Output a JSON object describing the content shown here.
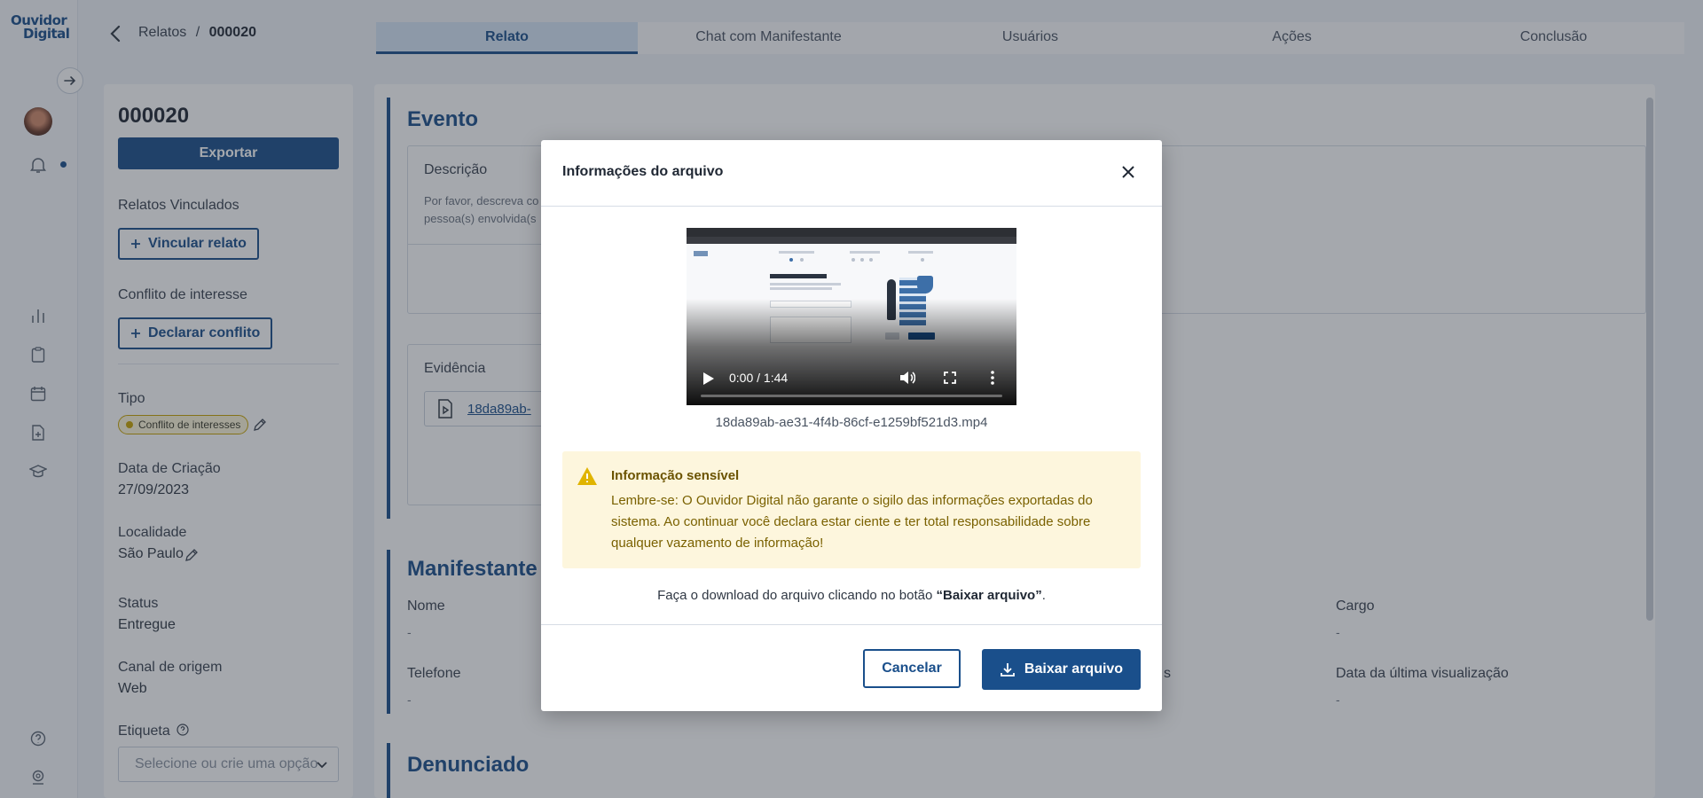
{
  "app": {
    "logo_line1": "Ouvidor",
    "logo_line2": "Digital"
  },
  "rail": {
    "icons": [
      "arrow-right-icon",
      "bell-icon",
      "bar-chart-icon",
      "clipboard-icon",
      "calendar-icon",
      "file-add-icon",
      "graduation-cap-icon",
      "help-circle-icon",
      "location-icon"
    ]
  },
  "header": {
    "breadcrumb_root": "Relatos",
    "breadcrumb_sep": "/",
    "breadcrumb_current": "000020",
    "tabs": [
      {
        "label": "Relato",
        "active": true
      },
      {
        "label": "Chat com Manifestante",
        "active": false
      },
      {
        "label": "Usuários",
        "active": false
      },
      {
        "label": "Ações",
        "active": false
      },
      {
        "label": "Conclusão",
        "active": false
      }
    ]
  },
  "left_panel": {
    "report_id": "000020",
    "export_label": "Exportar",
    "linked_reports_label": "Relatos Vinculados",
    "link_report_button": "Vincular relato",
    "conflict_label": "Conflito de interesse",
    "declare_conflict_button": "Declarar conflito",
    "type_label": "Tipo",
    "type_value": "Conflito de interesses",
    "created_label": "Data de Criação",
    "created_value": "27/09/2023",
    "location_label": "Localidade",
    "location_value": "São Paulo",
    "status_label": "Status",
    "status_value": "Entregue",
    "channel_label": "Canal de origem",
    "channel_value": "Web",
    "tag_label": "Etiqueta",
    "tag_placeholder": "Selecione ou crie uma opção"
  },
  "main": {
    "event_title": "Evento",
    "description_label": "Descrição",
    "description_line1": "Por favor, descreva co",
    "description_line2": "pessoa(s) envolvida(s",
    "evidence_label": "Evidência",
    "evidence_file_partial": "18da89ab-",
    "manifestante_title": "Manifestante",
    "name_label": "Nome",
    "name_value": "-",
    "role_label": "Cargo",
    "role_value": "-",
    "phone_label": "Telefone",
    "phone_value": "-",
    "hidden_label_fragment": "s",
    "last_view_label": "Data da última visualização",
    "last_view_value": "-",
    "denunciado_title": "Denunciado"
  },
  "modal": {
    "title": "Informações do arquivo",
    "video": {
      "time": "0:00 / 1:44",
      "progress": 0
    },
    "file_name": "18da89ab-ae31-4f4b-86cf-e1259bf521d3.mp4",
    "alert_title": "Informação sensível",
    "alert_text": "Lembre-se: O Ouvidor Digital não garante o sigilo das informações exportadas do sistema. Ao continuar você declara estar ciente e ter total responsabilidade sobre qualquer vazamento de informação!",
    "hint_prefix": "Faça o download do arquivo clicando no botão ",
    "hint_button": "“Baixar arquivo”",
    "hint_suffix": ".",
    "cancel_label": "Cancelar",
    "download_label": "Baixar arquivo"
  },
  "colors": {
    "brand": "#1a4f8b",
    "active_tab_bg": "#d6e6f6",
    "alert_bg": "#fdf6dd",
    "alert_text": "#7a6100",
    "tag_border": "#c9a400"
  }
}
